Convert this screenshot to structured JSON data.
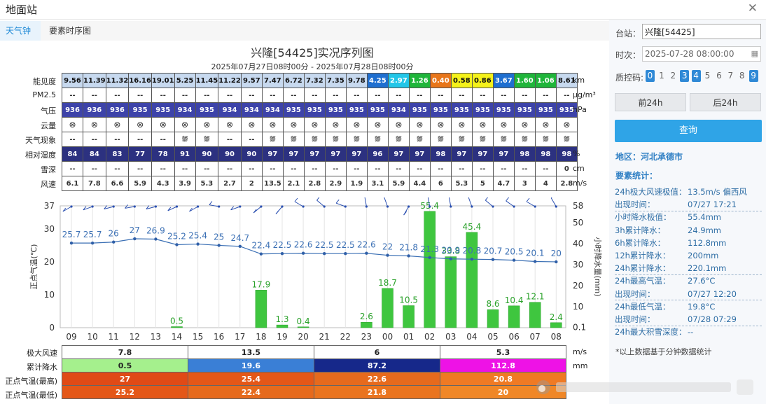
{
  "window": {
    "title": "地面站"
  },
  "tabs": [
    "天气钟",
    "要素时序图"
  ],
  "chart": {
    "title": "兴隆[54425]实况序列图",
    "subtitle": "2025年07月27日08时00分 - 2025年07月28日08时00分"
  },
  "table": {
    "rows": [
      {
        "label": "能见度",
        "unit": "km"
      },
      {
        "label": "PM2.5",
        "unit": "μg/m³"
      },
      {
        "label": "气压",
        "unit": "hPa"
      },
      {
        "label": "云量",
        "unit": ""
      },
      {
        "label": "天气现象",
        "unit": ""
      },
      {
        "label": "相对湿度",
        "unit": "%"
      },
      {
        "label": "雪深",
        "unit": "cm"
      },
      {
        "label": "风速",
        "unit": "m/s"
      }
    ],
    "visibility": [
      "9.56",
      "11.39",
      "11.32",
      "16.16",
      "19.01",
      "5.25",
      "11.45",
      "11.22",
      "9.57",
      "7.47",
      "6.72",
      "7.32",
      "7.35",
      "9.78",
      "4.25",
      "2.97",
      "1.26",
      "0.40",
      "0.58",
      "0.86",
      "3.67",
      "1.60",
      "1.06",
      "8.61"
    ],
    "visibility_colors": [
      "#c7d9ef",
      "#c7d9ef",
      "#c7d9ef",
      "#c7d9ef",
      "#c7d9ef",
      "#c7d9ef",
      "#c7d9ef",
      "#c7d9ef",
      "#c7d9ef",
      "#c7d9ef",
      "#c7d9ef",
      "#c7d9ef",
      "#c7d9ef",
      "#c7d9ef",
      "#1f6fd0",
      "#21c6e8",
      "#1fb53a",
      "#e8761a",
      "#f5f21a",
      "#f5f21a",
      "#1f6fd0",
      "#1fb53a",
      "#1fb53a",
      "#c7d9ef"
    ],
    "pm25": [
      "--",
      "--",
      "--",
      "--",
      "--",
      "--",
      "--",
      "--",
      "--",
      "--",
      "--",
      "--",
      "--",
      "--",
      "--",
      "--",
      "--",
      "--",
      "--",
      "--",
      "--",
      "--",
      "--",
      "--"
    ],
    "pressure": [
      "936",
      "936",
      "936",
      "935",
      "935",
      "934",
      "935",
      "934",
      "934",
      "934",
      "935",
      "935",
      "935",
      "935",
      "935",
      "934",
      "935",
      "935",
      "935",
      "935",
      "935",
      "935",
      "935",
      "935"
    ],
    "cloud": [
      "⊗",
      "⊗",
      "⊗",
      "⊗",
      "⊗",
      "⊗",
      "⊗",
      "⊗",
      "⊗",
      "⊗",
      "⊗",
      "⊗",
      "⊗",
      "⊗",
      "⊗",
      "⊗",
      "⊗",
      "⊗",
      "⊗",
      "⊗",
      "⊗",
      "⊗",
      "⊗",
      "⊗"
    ],
    "weather": [
      "--",
      "--",
      "--",
      "--",
      "--",
      "⛆",
      "⛆",
      "--",
      "--",
      "⛆",
      "⛆",
      "⛆",
      "⛆",
      "⛆",
      "⛆",
      "⛆",
      "⛆",
      "⛆",
      "⛆",
      "⛆",
      "⛆",
      "⛆",
      "⛆",
      "⛆"
    ],
    "humidity": [
      "84",
      "84",
      "83",
      "77",
      "78",
      "91",
      "90",
      "90",
      "90",
      "97",
      "97",
      "97",
      "97",
      "97",
      "96",
      "97",
      "97",
      "98",
      "97",
      "97",
      "97",
      "98",
      "98",
      "98"
    ],
    "snow": [
      "--",
      "--",
      "--",
      "--",
      "--",
      "--",
      "--",
      "--",
      "--",
      "--",
      "--",
      "--",
      "--",
      "--",
      "--",
      "--",
      "--",
      "--",
      "--",
      "--",
      "--",
      "--",
      "--",
      "0"
    ],
    "wind": [
      "6.1",
      "7.8",
      "6.6",
      "5.9",
      "4.3",
      "3.9",
      "5.3",
      "2.7",
      "2",
      "13.5",
      "2.1",
      "2.8",
      "2.9",
      "1.9",
      "3.1",
      "5.9",
      "4.4",
      "6",
      "5.3",
      "5",
      "4.7",
      "3",
      "4",
      "2.8"
    ]
  },
  "chart_data": {
    "type": "bar",
    "x": [
      "09",
      "10",
      "11",
      "12",
      "13",
      "14",
      "15",
      "16",
      "17",
      "18",
      "19",
      "20",
      "21",
      "22",
      "23",
      "00",
      "01",
      "02",
      "03",
      "04",
      "05",
      "06",
      "07",
      "08"
    ],
    "left_axis": {
      "label": "正点气温(℃)",
      "ticks": [
        0,
        10,
        20,
        30,
        37
      ],
      "range": [
        0,
        37
      ]
    },
    "right_axis": {
      "label": "小时降水量(mm)",
      "ticks": [
        "0.1",
        "10",
        "20",
        "30",
        "40",
        "50",
        "58"
      ],
      "range": [
        0,
        58
      ]
    },
    "series": [
      {
        "name": "正点气温",
        "type": "line",
        "values": [
          25.7,
          25.7,
          26,
          27,
          26.9,
          25.2,
          25.4,
          25,
          24.7,
          22.4,
          22.5,
          22.6,
          22.5,
          22.5,
          22.6,
          22,
          21.8,
          21.3,
          20.9,
          20.8,
          20.7,
          20.5,
          20.1,
          20
        ]
      },
      {
        "name": "小时降水量",
        "type": "bar",
        "values": [
          0,
          0,
          0,
          0,
          0,
          0.5,
          0,
          0,
          0,
          17.9,
          1.3,
          0.4,
          0,
          0,
          2.6,
          18.7,
          10.5,
          55.4,
          33.8,
          45.4,
          8.6,
          10.4,
          12.1,
          2.4
        ]
      }
    ],
    "wind_barbs": true
  },
  "summary": {
    "rows": [
      {
        "label": "极大风速",
        "unit": "m/s",
        "values": [
          "7.8",
          "13.5",
          "6",
          "5.3"
        ],
        "colors": [
          "#ffffff",
          "#ffffff",
          "#ffffff",
          "#ffffff"
        ]
      },
      {
        "label": "累计降水",
        "unit": "mm",
        "values": [
          "0.5",
          "19.6",
          "87.2",
          "112.8"
        ],
        "colors": [
          "#a5f08d",
          "#3a7fd6",
          "#16288a",
          "#ee12e6"
        ]
      },
      {
        "label": "正点气温(最高)",
        "unit": "",
        "values": [
          "27",
          "25.4",
          "22.6",
          "20.8"
        ],
        "colors": [
          "#e04a16",
          "#e45718",
          "#e66a1d",
          "#ef7a24"
        ]
      },
      {
        "label": "正点气温(最低)",
        "unit": "",
        "values": [
          "25.2",
          "22.4",
          "21.8",
          "20"
        ],
        "colors": [
          "#e45718",
          "#e66a1d",
          "#ea741f",
          "#f08727"
        ]
      }
    ]
  },
  "form": {
    "station_label": "台站：",
    "station_value": "兴隆[54425]",
    "time_label": "时次：",
    "time_value": "2025-07-28 08:00:00",
    "qc_label": "质控码:",
    "qc_codes": [
      "0",
      "1",
      "2",
      "3",
      "4",
      "5",
      "6",
      "7",
      "8",
      "9"
    ],
    "qc_active": [
      true,
      false,
      false,
      true,
      true,
      false,
      false,
      false,
      false,
      true
    ],
    "prev_label": "前24h",
    "next_label": "后24h",
    "query_label": "查询"
  },
  "region": "地区：河北承德市",
  "stats": {
    "title": "要素统计：",
    "items": [
      {
        "k": "24h极大风速极值：",
        "v": "13.5m/s 偏西风"
      },
      {
        "k": "出现时间：",
        "v": "07/27 17:21"
      },
      {
        "k": "小时降水极值：",
        "v": "55.4mm"
      },
      {
        "k": "3h累计降水：",
        "v": "24.9mm"
      },
      {
        "k": "6h累计降水：",
        "v": "112.8mm"
      },
      {
        "k": "12h累计降水：",
        "v": "200mm"
      },
      {
        "k": "24h累计降水：",
        "v": "220.1mm"
      },
      {
        "k": "24h最高气温：",
        "v": "27.6°C"
      },
      {
        "k": "出现时间：",
        "v": "07/27 12:20"
      },
      {
        "k": "24h最低气温：",
        "v": "19.8°C"
      },
      {
        "k": "出现时间：",
        "v": "07/28 07:29"
      },
      {
        "k": "24h最大积雪深度：",
        "v": "--"
      }
    ],
    "note": "*以上数据基于分钟数据统计"
  }
}
